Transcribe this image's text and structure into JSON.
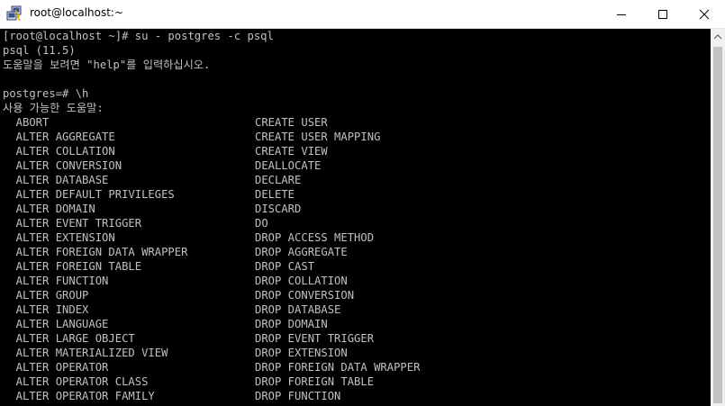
{
  "window": {
    "title": "root@localhost:~"
  },
  "terminal": {
    "header_lines": [
      "[root@localhost ~]# su - postgres -c psql",
      "psql (11.5)",
      "도움말을 보려면 \"help\"를 입력하십시오.",
      "",
      "postgres=# \\h",
      "사용 가능한 도움말:"
    ],
    "help_rows": [
      [
        "ABORT",
        "CREATE USER"
      ],
      [
        "ALTER AGGREGATE",
        "CREATE USER MAPPING"
      ],
      [
        "ALTER COLLATION",
        "CREATE VIEW"
      ],
      [
        "ALTER CONVERSION",
        "DEALLOCATE"
      ],
      [
        "ALTER DATABASE",
        "DECLARE"
      ],
      [
        "ALTER DEFAULT PRIVILEGES",
        "DELETE"
      ],
      [
        "ALTER DOMAIN",
        "DISCARD"
      ],
      [
        "ALTER EVENT TRIGGER",
        "DO"
      ],
      [
        "ALTER EXTENSION",
        "DROP ACCESS METHOD"
      ],
      [
        "ALTER FOREIGN DATA WRAPPER",
        "DROP AGGREGATE"
      ],
      [
        "ALTER FOREIGN TABLE",
        "DROP CAST"
      ],
      [
        "ALTER FUNCTION",
        "DROP COLLATION"
      ],
      [
        "ALTER GROUP",
        "DROP CONVERSION"
      ],
      [
        "ALTER INDEX",
        "DROP DATABASE"
      ],
      [
        "ALTER LANGUAGE",
        "DROP DOMAIN"
      ],
      [
        "ALTER LARGE OBJECT",
        "DROP EVENT TRIGGER"
      ],
      [
        "ALTER MATERIALIZED VIEW",
        "DROP EXTENSION"
      ],
      [
        "ALTER OPERATOR",
        "DROP FOREIGN DATA WRAPPER"
      ],
      [
        "ALTER OPERATOR CLASS",
        "DROP FOREIGN TABLE"
      ],
      [
        "ALTER OPERATOR FAMILY",
        "DROP FUNCTION"
      ]
    ]
  },
  "icons": {
    "app": "putty-icon",
    "minimize": "minimize-icon",
    "maximize": "maximize-icon",
    "close": "close-icon",
    "scroll_up": "scroll-up-arrow-icon"
  },
  "colors": {
    "terminal_bg": "#000000",
    "terminal_text": "#c0c0c0",
    "titlebar_bg": "#ffffff"
  }
}
